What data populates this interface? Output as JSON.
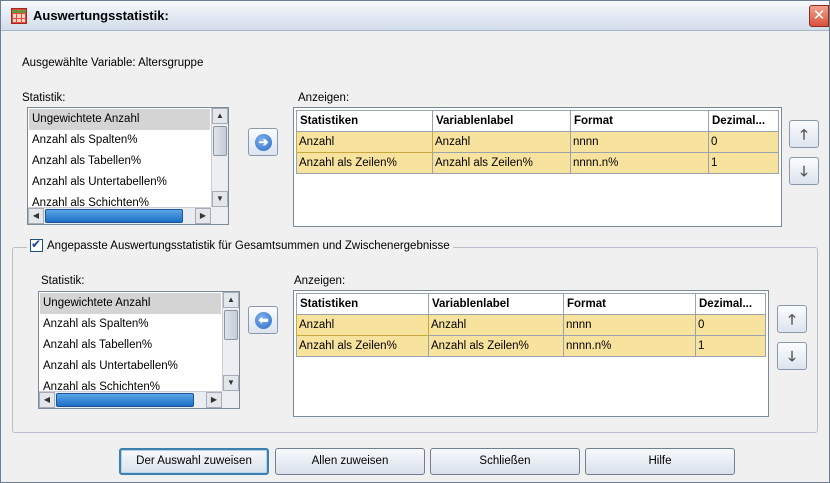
{
  "window": {
    "title": "Auswertungsstatistik:",
    "close_symbol": "✕"
  },
  "selected_variable": "Ausgewählte Variable: Altersgruppe",
  "top": {
    "statistik_label": "Statistik:",
    "anzeigen_label": "Anzeigen:",
    "list_items": [
      "Ungewichtete Anzahl",
      "Anzahl als Spalten%",
      "Anzahl als Tabellen%",
      "Anzahl als Untertabellen%",
      "Anzahl als Schichten%"
    ],
    "selected_index": 0,
    "move_symbol": "➔",
    "grid": {
      "headers": [
        "Statistiken",
        "Variablenlabel",
        "Format",
        "Dezimal..."
      ],
      "rows": [
        [
          "Anzahl",
          "Anzahl",
          "nnnn",
          "0"
        ],
        [
          "Anzahl als Zeilen%",
          "Anzahl als Zeilen%",
          "nnnn.n%",
          "1"
        ]
      ]
    }
  },
  "group": {
    "checkbox_label": "Angepasste Auswertungsstatistik für Gesamtsummen und Zwischenergebnisse",
    "checked": true,
    "statistik_label": "Statistik:",
    "anzeigen_label": "Anzeigen:",
    "list_items": [
      "Ungewichtete Anzahl",
      "Anzahl als Spalten%",
      "Anzahl als Tabellen%",
      "Anzahl als Untertabellen%",
      "Anzahl als Schichten%"
    ],
    "selected_index": 0,
    "move_symbol": "⬅",
    "grid": {
      "headers": [
        "Statistiken",
        "Variablenlabel",
        "Format",
        "Dezimal..."
      ],
      "rows": [
        [
          "Anzahl",
          "Anzahl",
          "nnnn",
          "0"
        ],
        [
          "Anzahl als Zeilen%",
          "Anzahl als Zeilen%",
          "nnnn.n%",
          "1"
        ]
      ]
    }
  },
  "order_buttons": {
    "up": "🡑",
    "down": "🡓"
  },
  "buttons": {
    "assign_selection": "Der Auswahl zuweisen",
    "assign_all": "Allen zuweisen",
    "close": "Schließen",
    "help": "Hilfe"
  },
  "colors": {
    "selected_row": "#f8e39e",
    "list_selection": "#d4d4d4",
    "accent": "#2a6ac8"
  }
}
